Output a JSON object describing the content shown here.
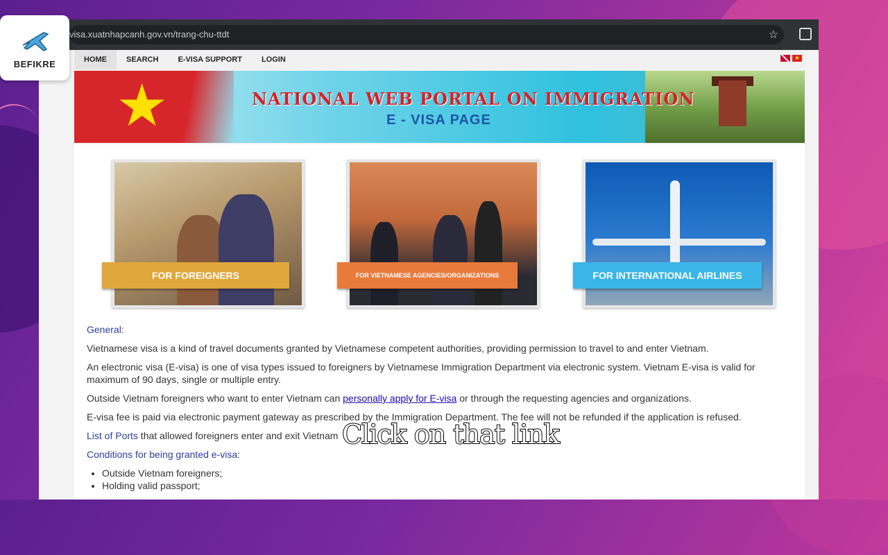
{
  "overlay": {
    "brand": "BEFIKRE",
    "caption": "Click on that link"
  },
  "browser": {
    "url": "visa.xuatnhapcanh.gov.vn/trang-chu-ttdt"
  },
  "nav": {
    "items": [
      {
        "label": "HOME",
        "active": true
      },
      {
        "label": "SEARCH"
      },
      {
        "label": "E-VISA SUPPORT"
      },
      {
        "label": "LOGIN"
      }
    ]
  },
  "banner": {
    "title": "NATIONAL WEB PORTAL ON IMMIGRATION",
    "subtitle": "E - VISA PAGE"
  },
  "cards": [
    {
      "label": "FOR FOREIGNERS"
    },
    {
      "label": "FOR VIETNAMESE AGENCIES/ORGANIZATIONS"
    },
    {
      "label": "FOR INTERNATIONAL AIRLINES"
    }
  ],
  "content": {
    "general_heading": "General:",
    "p1": "Vietnamese visa is a kind of travel documents granted by Vietnamese competent authorities, providing permission to travel to and enter Vietnam.",
    "p2": "An electronic visa (E-visa) is one of visa types issued to foreigners by Vietnamese Immigration Department via electronic system. Vietnam E-visa is valid for maximum of 90 days, single or multiple entry.",
    "p3_before": "Outside Vietnam foreigners who want to enter Vietnam can ",
    "p3_link": "personally apply for E-visa",
    "p3_after": " or through the requesting agencies and organizations.",
    "p4": "E-visa fee is paid via electronic payment gateway as prescribed by the Immigration Department. The fee will not be refunded if the application is refused.",
    "p5_link": "List of Ports",
    "p5_after": " that allowed foreigners enter and exit Vietnam",
    "conditions_heading": "Conditions for being granted e-visa:",
    "conditions": [
      "Outside Vietnam foreigners;",
      "Holding valid passport;"
    ]
  },
  "colors": {
    "link": "#1a0dab",
    "heading_blue": "#2d3d9c",
    "banner_red": "#d1232a",
    "card_yellow": "#e0a73c",
    "card_orange": "#e87a3b",
    "card_blue": "#3bb5e7"
  }
}
